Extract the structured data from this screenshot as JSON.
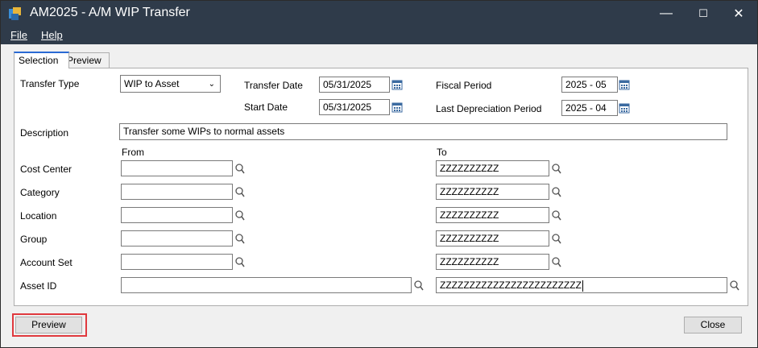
{
  "window": {
    "title": "AM2025 - A/M WIP Transfer",
    "controls": [
      "—",
      "☐",
      "✕"
    ]
  },
  "menu": {
    "file": "File",
    "help": "Help"
  },
  "tabs": [
    {
      "label": "Selection",
      "active": true
    },
    {
      "label": "Preview",
      "active": false
    }
  ],
  "form": {
    "transfer_type_label": "Transfer Type",
    "transfer_type_value": "WIP to Asset",
    "transfer_date_label": "Transfer Date",
    "transfer_date_value": "05/31/2025",
    "start_date_label": "Start Date",
    "start_date_value": "05/31/2025",
    "fiscal_period_label": "Fiscal Period",
    "fiscal_period_value": "2025 - 05",
    "last_depr_label": "Last Depreciation Period",
    "last_depr_value": "2025 - 04",
    "description_label": "Description",
    "description_value": "Transfer some WIPs to normal assets",
    "from_header": "From",
    "to_header": "To",
    "ranges": [
      {
        "label": "Cost Center",
        "from": "",
        "to": "ZZZZZZZZZZ"
      },
      {
        "label": "Category",
        "from": "",
        "to": "ZZZZZZZZZZ"
      },
      {
        "label": "Location",
        "from": "",
        "to": "ZZZZZZZZZZ"
      },
      {
        "label": "Group",
        "from": "",
        "to": "ZZZZZZZZZZ"
      },
      {
        "label": "Account Set",
        "from": "",
        "to": "ZZZZZZZZZZ"
      },
      {
        "label": "Asset ID",
        "from": "",
        "to": "ZZZZZZZZZZZZZZZZZZZZZZZZ"
      }
    ]
  },
  "buttons": {
    "preview": "Preview",
    "close": "Close"
  },
  "colors": {
    "titlebar": "#2f3b4a",
    "highlight": "#e0393e",
    "tab_accent": "#2a6ad4"
  }
}
